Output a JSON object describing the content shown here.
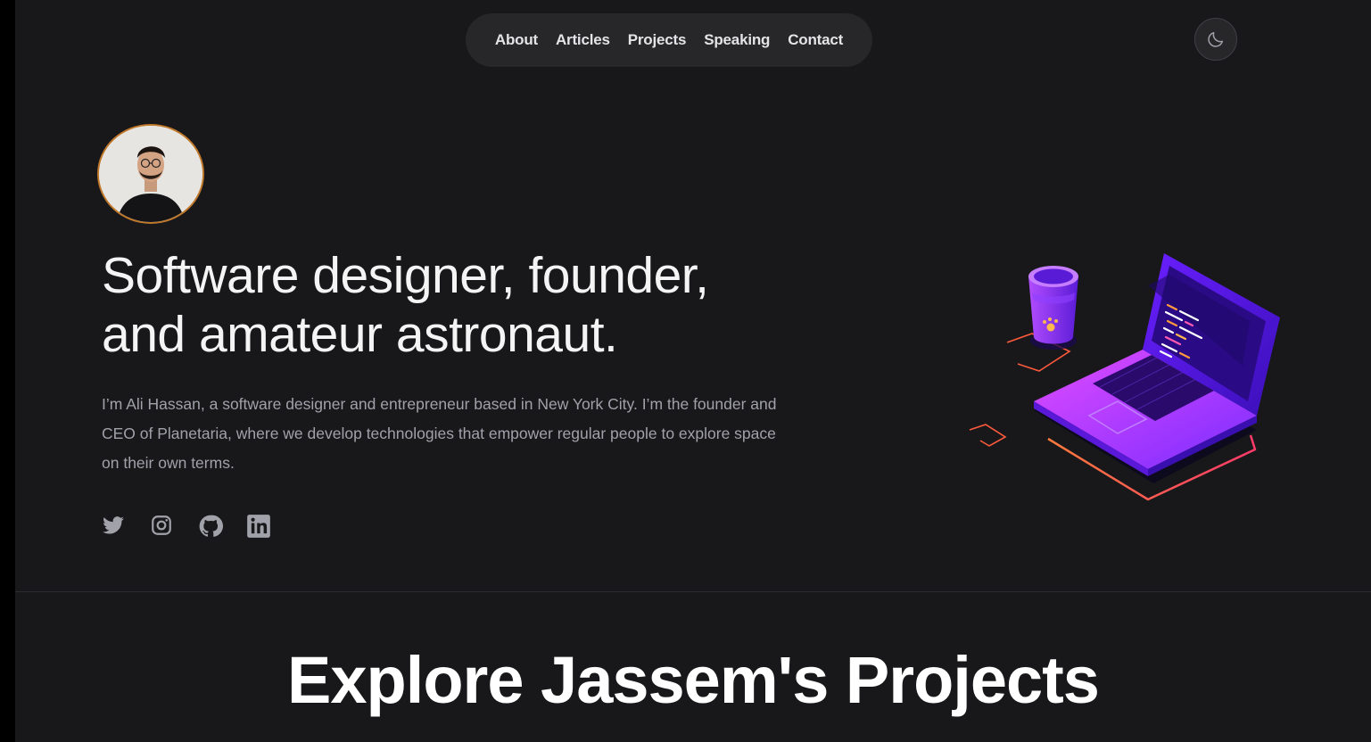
{
  "nav": {
    "items": [
      "About",
      "Articles",
      "Projects",
      "Speaking",
      "Contact"
    ]
  },
  "theme_toggle": {
    "icon": "moon-icon"
  },
  "hero": {
    "title_line1": "Software designer, founder,",
    "title_line2": "and amateur astronaut.",
    "bio": "I’m Ali Hassan, a software designer and entrepreneur based in New York City. I’m the founder and CEO of Planetaria, where we develop technologies that empower regular people to explore space on their own terms."
  },
  "socials": [
    {
      "name": "twitter-icon"
    },
    {
      "name": "instagram-icon"
    },
    {
      "name": "github-icon"
    },
    {
      "name": "linkedin-icon"
    }
  ],
  "projects": {
    "title": "Explore Jassem's Projects"
  },
  "colors": {
    "background": "#18181b",
    "nav_pill": "#27272a",
    "text": "#f4f4f5",
    "muted": "#a1a1aa",
    "avatar_ring": "#c0782a",
    "accent_purple": "#8b3dff",
    "accent_orange": "#ff5a3c"
  }
}
